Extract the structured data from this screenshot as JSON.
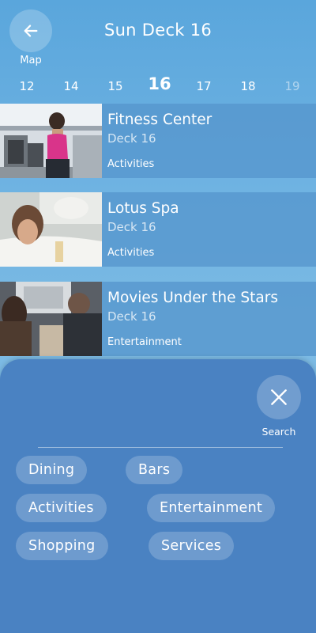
{
  "header": {
    "back_label": "Map",
    "title": "Sun Deck 16"
  },
  "decks": [
    "12",
    "14",
    "15",
    "16",
    "17",
    "18",
    "19"
  ],
  "selected_deck": "16",
  "venues": [
    {
      "name": "Fitness Center",
      "deck": "Deck 16",
      "category": "Activities"
    },
    {
      "name": "Lotus Spa",
      "deck": "Deck 16",
      "category": "Activities"
    },
    {
      "name": "Movies Under the Stars",
      "deck": "Deck 16",
      "category": "Entertainment"
    }
  ],
  "filter_panel": {
    "search_label": "Search",
    "chips": [
      "Dining",
      "Bars",
      "Activities",
      "Entertainment",
      "Shopping",
      "Services"
    ]
  },
  "colors": {
    "panel": "#4a82c2",
    "row": "#5696cd"
  }
}
